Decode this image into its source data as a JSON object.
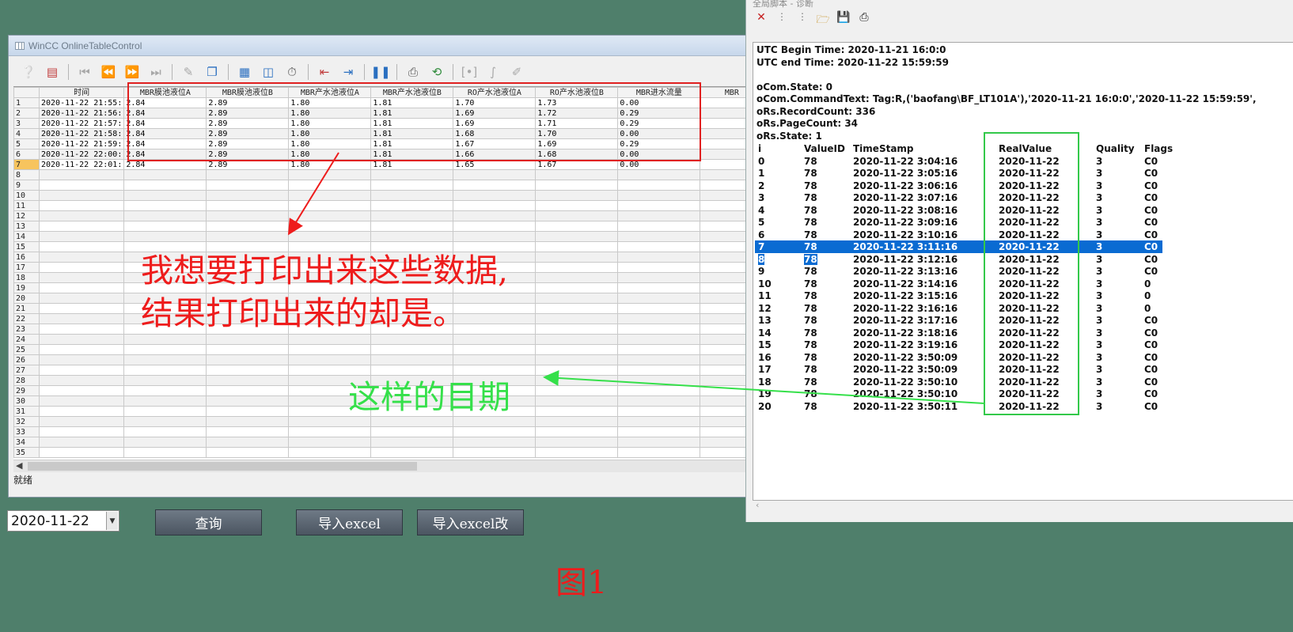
{
  "left_window": {
    "title": "WinCC OnlineTableControl",
    "status": "就绪",
    "columns": [
      "时间",
      "MBR膜池液位A",
      "MBR膜池液位B",
      "MBR产水池液位A",
      "MBR产水池液位B",
      "RO产水池液位A",
      "RO产水池液位B",
      "MBR进水流量",
      "MBR"
    ],
    "rows": [
      {
        "n": "1",
        "cells": [
          "2020-11-22 21:55:",
          "2.84",
          "2.89",
          "1.80",
          "1.81",
          "1.70",
          "1.73",
          "0.00",
          ""
        ]
      },
      {
        "n": "2",
        "cells": [
          "2020-11-22 21:56:",
          "2.84",
          "2.89",
          "1.80",
          "1.81",
          "1.69",
          "1.72",
          "0.29",
          ""
        ]
      },
      {
        "n": "3",
        "cells": [
          "2020-11-22 21:57:",
          "2.84",
          "2.89",
          "1.80",
          "1.81",
          "1.69",
          "1.71",
          "0.29",
          ""
        ]
      },
      {
        "n": "4",
        "cells": [
          "2020-11-22 21:58:",
          "2.84",
          "2.89",
          "1.80",
          "1.81",
          "1.68",
          "1.70",
          "0.00",
          ""
        ]
      },
      {
        "n": "5",
        "cells": [
          "2020-11-22 21:59:",
          "2.84",
          "2.89",
          "1.80",
          "1.81",
          "1.67",
          "1.69",
          "0.29",
          ""
        ]
      },
      {
        "n": "6",
        "cells": [
          "2020-11-22 22:00:",
          "2.84",
          "2.89",
          "1.80",
          "1.81",
          "1.66",
          "1.68",
          "0.00",
          ""
        ]
      },
      {
        "n": "7",
        "cells": [
          "2020-11-22 22:01:",
          "2.84",
          "2.89",
          "1.80",
          "1.81",
          "1.65",
          "1.67",
          "0.00",
          ""
        ]
      }
    ],
    "empty_row_numbers": [
      "8",
      "9",
      "10",
      "11",
      "12",
      "13",
      "14",
      "15",
      "16",
      "17",
      "18",
      "19",
      "20",
      "21",
      "22",
      "23",
      "24",
      "25",
      "26",
      "27",
      "28",
      "29",
      "30",
      "31",
      "32",
      "33",
      "34",
      "35"
    ],
    "selected_row": "7",
    "toolbar_icons": [
      "help-icon",
      "config-icon",
      "first-record-icon",
      "previous-record-icon",
      "next-record-icon",
      "last-record-icon",
      "edit-icon",
      "copy-icon",
      "select-columns-icon",
      "column-config-icon",
      "time-base-icon",
      "export-left-icon",
      "export-right-icon",
      "pause-icon",
      "print-icon",
      "refresh-icon",
      "interval-icon",
      "statistics-icon",
      "pen-add-icon"
    ]
  },
  "right_window": {
    "title": "全局脚本 - 诊断",
    "lines": [
      "UTC Begin Time: 2020-11-21 16:0:0",
      "UTC end Time: 2020-11-22 15:59:59",
      "",
      "oCom.State: 0",
      "oCom.CommandText: Tag:R,('baofang\\BF_LT101A'),'2020-11-21 16:0:0','2020-11-22 15:59:59',",
      "oRs.RecordCount: 336",
      "oRs.PageCount: 34",
      "oRs.State: 1"
    ],
    "headers": [
      "i",
      "ValueID",
      "TimeStamp",
      "RealValue",
      "Quality",
      "Flags"
    ],
    "rows": [
      [
        "0",
        "78",
        "2020-11-22 3:04:16",
        "2020-11-22",
        "3",
        "C0"
      ],
      [
        "1",
        "78",
        "2020-11-22 3:05:16",
        "2020-11-22",
        "3",
        "C0"
      ],
      [
        "2",
        "78",
        "2020-11-22 3:06:16",
        "2020-11-22",
        "3",
        "C0"
      ],
      [
        "3",
        "78",
        "2020-11-22 3:07:16",
        "2020-11-22",
        "3",
        "C0"
      ],
      [
        "4",
        "78",
        "2020-11-22 3:08:16",
        "2020-11-22",
        "3",
        "C0"
      ],
      [
        "5",
        "78",
        "2020-11-22 3:09:16",
        "2020-11-22",
        "3",
        "C0"
      ],
      [
        "6",
        "78",
        "2020-11-22 3:10:16",
        "2020-11-22",
        "3",
        "C0"
      ],
      [
        "7",
        "78",
        "2020-11-22 3:11:16",
        "2020-11-22",
        "3",
        "C0"
      ],
      [
        "8",
        "78",
        "2020-11-22 3:12:16",
        "2020-11-22",
        "3",
        "C0"
      ],
      [
        "9",
        "78",
        "2020-11-22 3:13:16",
        "2020-11-22",
        "3",
        "C0"
      ],
      [
        "10",
        "78",
        "2020-11-22 3:14:16",
        "2020-11-22",
        "3",
        "0"
      ],
      [
        "11",
        "78",
        "2020-11-22 3:15:16",
        "2020-11-22",
        "3",
        "0"
      ],
      [
        "12",
        "78",
        "2020-11-22 3:16:16",
        "2020-11-22",
        "3",
        "0"
      ],
      [
        "13",
        "78",
        "2020-11-22 3:17:16",
        "2020-11-22",
        "3",
        "C0"
      ],
      [
        "14",
        "78",
        "2020-11-22 3:18:16",
        "2020-11-22",
        "3",
        "C0"
      ],
      [
        "15",
        "78",
        "2020-11-22 3:19:16",
        "2020-11-22",
        "3",
        "C0"
      ],
      [
        "16",
        "78",
        "2020-11-22 3:50:09",
        "2020-11-22",
        "3",
        "C0"
      ],
      [
        "17",
        "78",
        "2020-11-22 3:50:09",
        "2020-11-22",
        "3",
        "C0"
      ],
      [
        "18",
        "78",
        "2020-11-22 3:50:10",
        "2020-11-22",
        "3",
        "C0"
      ],
      [
        "19",
        "78",
        "2020-11-22 3:50:10",
        "2020-11-22",
        "3",
        "C0"
      ],
      [
        "20",
        "78",
        "2020-11-22 3:50:11",
        "2020-11-22",
        "3",
        "C0"
      ]
    ],
    "highlighted_row": "7",
    "partial_highlight_row": "8",
    "toolbar_icons": [
      "close-icon",
      "step-icon",
      "step-into-icon",
      "open-folder-icon",
      "save-icon",
      "print-icon"
    ]
  },
  "controls": {
    "date_value": "2020-11-22",
    "query_button": "查询",
    "import_button": "导入excel",
    "import_mod_button": "导入excel改"
  },
  "annotations": {
    "red_line1": "我想要打印出来这些数据,",
    "red_line2": "结果打印出来的却是。",
    "green_note": "这样的目期",
    "figure_label": "图1"
  },
  "colors": {
    "background": "#4f7f6b",
    "red_annotation": "#ee1c1c",
    "green_annotation": "#35e04a",
    "selection_blue": "#0a6bd2",
    "selected_row_orange": "#f7c45e"
  }
}
